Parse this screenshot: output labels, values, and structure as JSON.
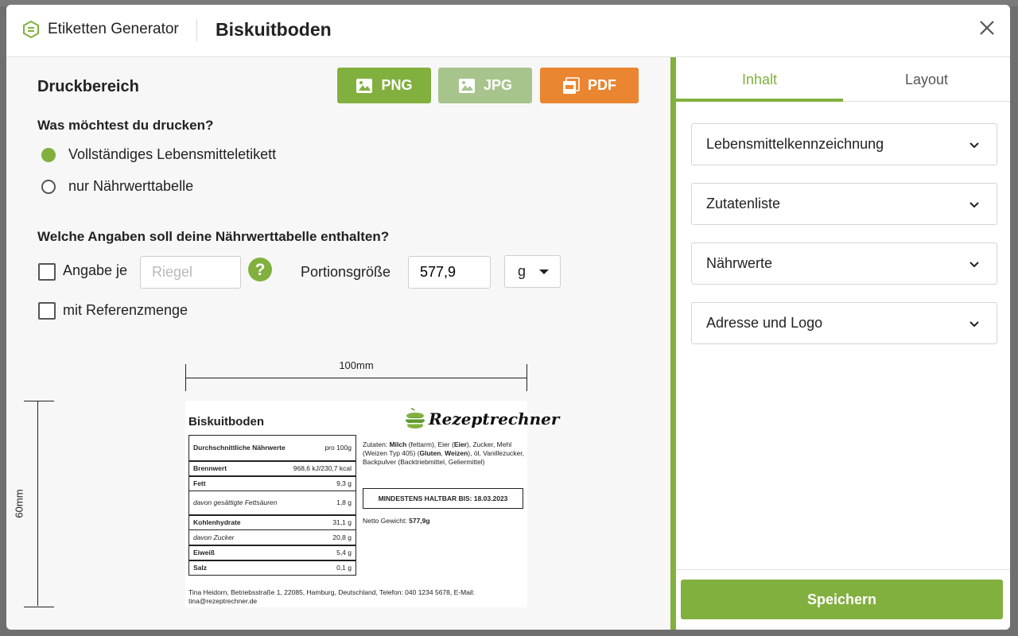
{
  "header": {
    "brand": "Etiketten Generator",
    "title": "Biskuitboden"
  },
  "print": {
    "title": "Druckbereich",
    "buttons": {
      "png": "PNG",
      "jpg": "JPG",
      "pdf": "PDF"
    },
    "question1": "Was möchtest du drucken?",
    "options": [
      "Vollständiges Lebensmitteletikett",
      "nur Nährwerttabelle"
    ],
    "selected_option": 0,
    "question2": "Welche Angaben soll deine Nährwerttabelle enthalten?",
    "angabe_je": {
      "label": "Angabe je",
      "placeholder": "Riegel",
      "checked": false
    },
    "portion": {
      "label": "Portionsgröße",
      "value": "577,9",
      "unit": "g"
    },
    "referenz": {
      "label": "mit Referenzmenge",
      "checked": false
    }
  },
  "preview": {
    "width_label": "100mm",
    "height_label": "60mm",
    "product": "Biskuitboden",
    "logo": "Rezeptrechner",
    "nutrition": {
      "header_label": "Durchschnittliche Nährwerte",
      "header_value": "pro 100g",
      "rows": [
        {
          "label": "Brennwert",
          "value": "968,6 kJ/230,7 kcal"
        },
        {
          "label": "Fett",
          "value": "9,3 g"
        },
        {
          "label": "davon gesättigte Fettsäuren",
          "value": "1,8 g"
        },
        {
          "label": "Kohlenhydrate",
          "value": "31,1 g"
        },
        {
          "label": "davon Zucker",
          "value": "20,8 g"
        },
        {
          "label": "Eiweiß",
          "value": "5,4 g"
        },
        {
          "label": "Salz",
          "value": "0,1 g"
        }
      ]
    },
    "ingredients": {
      "prefix": "Zutaten: ",
      "milch": "Milch",
      "p1": " (fettarm), Eier (",
      "eier": "Eier",
      "p2": "), Zucker, Mehl (Weizen Typ 405) (",
      "gluten": "Gluten",
      "comma": ", ",
      "weizen": "Weizen",
      "p3": "), öl, Vanillezucker, Backpulver (Backtriebmittel, Geliermittel)"
    },
    "mhd": "MINDESTENS HALTBAR BIS: 18.03.2023",
    "netto_label": "Netto Gewicht: ",
    "netto_value": "577,9g",
    "address": "Tina Heidorn, Betriebsstraße 1, 22085, Hamburg, Deutschland, Telefon: 040 1234 5678, E-Mail: tina@rezeptrechner.de"
  },
  "sidebar": {
    "tabs": [
      "Inhalt",
      "Layout"
    ],
    "active_tab": 0,
    "sections": [
      "Lebensmittelkennzeichnung",
      "Zutatenliste",
      "Nährwerte",
      "Adresse und Logo"
    ],
    "save": "Speichern"
  },
  "colors": {
    "accent": "#82b03f",
    "jpg": "#a7c48d",
    "pdf": "#ea8531"
  }
}
